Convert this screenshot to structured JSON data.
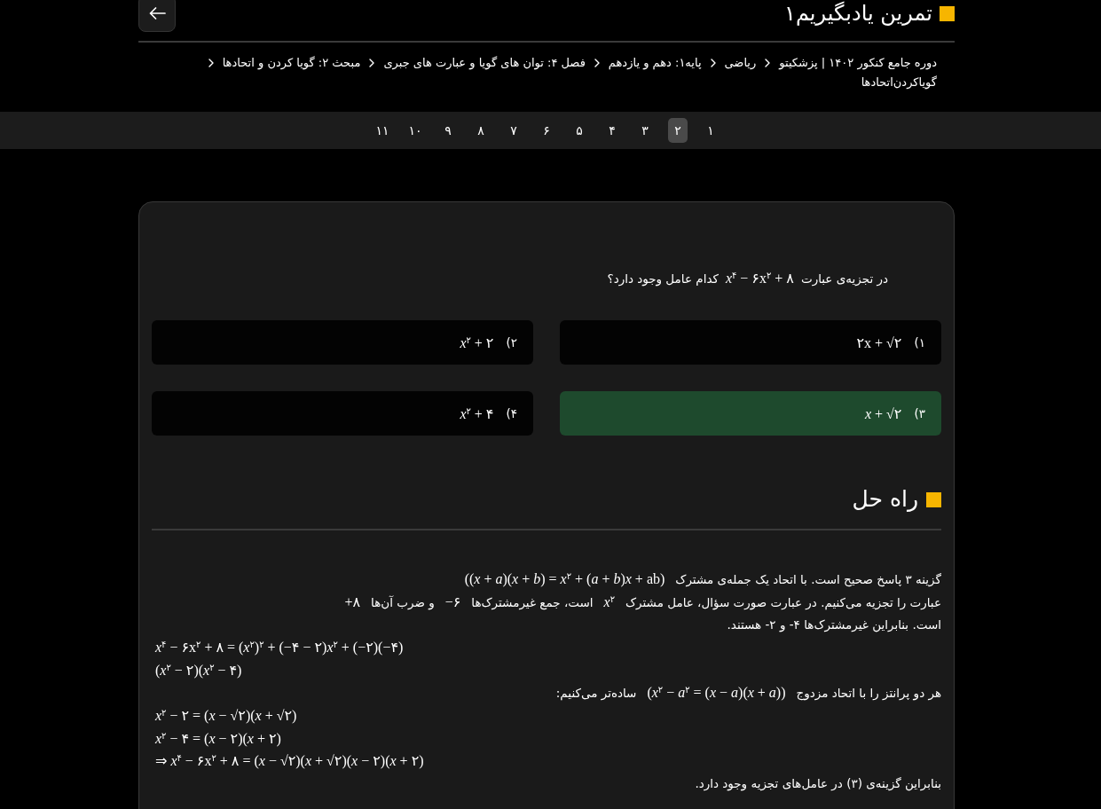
{
  "header": {
    "title": "تمرین یادبگیریم۱"
  },
  "breadcrumb": [
    "دوره جامع کنکور ۱۴۰۲ | پزشکیتو",
    "ریاضی",
    "پایه۱: دهم و یازدهم",
    "فصل ۴: توان های گویا و عبارت های جبری",
    "مبحث ۲: گویا کردن و اتحادها",
    "گویاکردن‌اتحادها"
  ],
  "pages": [
    {
      "label": "۱",
      "selected": false
    },
    {
      "label": "۲",
      "selected": true
    },
    {
      "label": "۳",
      "selected": false
    },
    {
      "label": "۴",
      "selected": false
    },
    {
      "label": "۵",
      "selected": false
    },
    {
      "label": "۶",
      "selected": false
    },
    {
      "label": "۷",
      "selected": false
    },
    {
      "label": "۸",
      "selected": false
    },
    {
      "label": "۹",
      "selected": false
    },
    {
      "label": "۱۰",
      "selected": false
    },
    {
      "label": "۱۱",
      "selected": false
    }
  ],
  "question": {
    "parts": [
      {
        "kind": "text",
        "text": "در تجزیه‌ی عبارت"
      },
      {
        "kind": "math",
        "text": "*x*$^{۴}$ − ۶x$^{۲}$ + ۸"
      },
      {
        "kind": "text",
        "text": "کدام عامل وجود دارد؟"
      }
    ]
  },
  "options": [
    {
      "label": "۱)",
      "math": "۲x + √۲",
      "correct": false
    },
    {
      "label": "۲)",
      "math": "*x*$^{۲}$ + ۲",
      "correct": false
    },
    {
      "label": "۳)",
      "math": "*x* + √۲",
      "correct": true
    },
    {
      "label": "۴)",
      "math": "*x*$^{۲}$ + ۴",
      "correct": false
    }
  ],
  "solution": {
    "title": "راه حل",
    "lines": [
      {
        "kind": "text",
        "parts": [
          {
            "kind": "text",
            "text": "گزینه ۳ پاسخ صحیح است. با اتحاد یک جمله‌ی مشترک"
          },
          {
            "kind": "math",
            "text": "((*x* + *a*)(*x* + *b*) = *x*$^{۲}$ + (*a* + *b*)*x* + ab)"
          }
        ]
      },
      {
        "kind": "text",
        "parts": [
          {
            "kind": "text",
            "text": "عبارت را تجزیه می‌کنیم. در عبارت صورت سؤال، عامل مشترک"
          },
          {
            "kind": "math",
            "text": "*x*$^{۲}$"
          },
          {
            "kind": "text",
            "text": "است، جمع غیرمشترک‌ها"
          },
          {
            "kind": "math",
            "text": "−۶"
          },
          {
            "kind": "text",
            "text": "و ضرب آن‌ها"
          },
          {
            "kind": "math",
            "text": "+۸"
          }
        ]
      },
      {
        "kind": "text",
        "parts": [
          {
            "kind": "text",
            "text": "است. بنابراین غیرمشترک‌ها ۴- و ۲- هستند."
          }
        ]
      },
      {
        "kind": "math",
        "text": "*x*$^{۴}$ − ۶x$^{۲}$ + ۸ = (*x*$^{۲}$)$^{۲}$ + (−۴ − ۲)*x*$^{۲}$ + (−۲)(−۴)"
      },
      {
        "kind": "math",
        "text": "(*x*$^{۲}$ − ۲)(*x*$^{۲}$ − ۴)"
      },
      {
        "kind": "text",
        "parts": [
          {
            "kind": "text",
            "text": "هر دو پرانتز را با اتحاد مزدوج"
          },
          {
            "kind": "math",
            "text": "(*x*$^{۲}$ − *a*$^{۲}$ = (*x* − *a*)(*x* + *a*))"
          },
          {
            "kind": "text",
            "text": "ساده‌تر می‌کنیم:"
          }
        ]
      },
      {
        "kind": "math",
        "text": "*x*$^{۲}$ − ۲ = (*x* − √۲)(*x* + √۲)"
      },
      {
        "kind": "math",
        "text": "*x*$^{۲}$ − ۴ = (*x* − ۲)(*x* + ۲)"
      },
      {
        "kind": "math",
        "text": "⇒ *x*$^{۴}$ − ۶x$^{۲}$ + ۸ = (*x* − √۲)(*x* + √۲)(*x* − ۲)(*x* + ۲)"
      },
      {
        "kind": "text",
        "parts": [
          {
            "kind": "text",
            "text": "بنابراین گزینه‌ی (۳) در عامل‌های تجزیه وجود دارد."
          }
        ]
      }
    ]
  }
}
